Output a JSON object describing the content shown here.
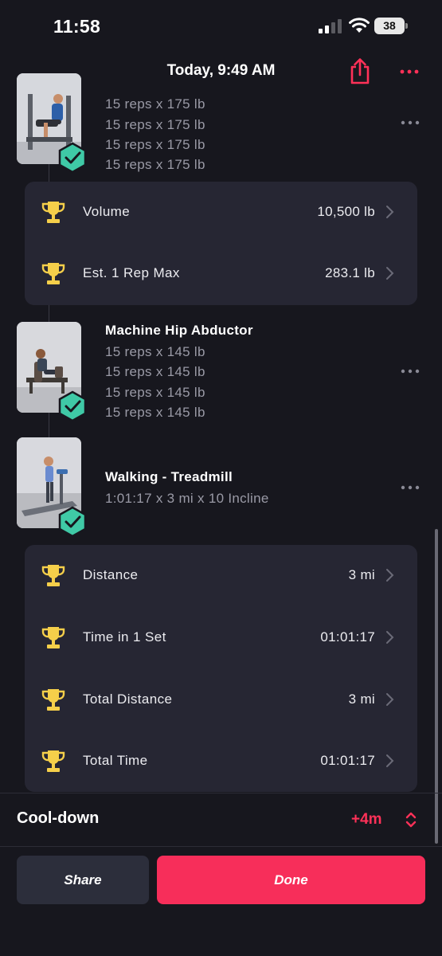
{
  "status_bar": {
    "time": "11:58",
    "battery": "38"
  },
  "header": {
    "title": "Today, 9:49 AM"
  },
  "exercises": [
    {
      "name": "",
      "sets": [
        "15 reps x 175 lb",
        "15 reps x 175 lb",
        "15 reps x 175 lb",
        "15 reps x 175 lb"
      ]
    },
    {
      "name": "Machine Hip Abductor",
      "sets": [
        "15 reps x 145 lb",
        "15 reps x 145 lb",
        "15 reps x 145 lb",
        "15 reps x 145 lb"
      ]
    },
    {
      "name": "Walking - Treadmill",
      "sets": [
        "1:01:17 x 3 mi x 10 Incline"
      ]
    }
  ],
  "records_1": [
    {
      "label": "Volume",
      "value": "10,500 lb"
    },
    {
      "label": "Est. 1 Rep Max",
      "value": "283.1 lb"
    }
  ],
  "records_2": [
    {
      "label": "Distance",
      "value": "3 mi"
    },
    {
      "label": "Time in 1 Set",
      "value": "01:01:17"
    },
    {
      "label": "Total Distance",
      "value": "3 mi"
    },
    {
      "label": "Total Time",
      "value": "01:01:17"
    }
  ],
  "cooldown": {
    "label": "Cool-down",
    "value": "+4m"
  },
  "buttons": {
    "share": "Share",
    "done": "Done"
  },
  "colors": {
    "accent": "#f72e5a",
    "badge": "#3fc9a6",
    "trophy": "#f5cf4a",
    "card": "#262633",
    "background": "#17171e"
  }
}
